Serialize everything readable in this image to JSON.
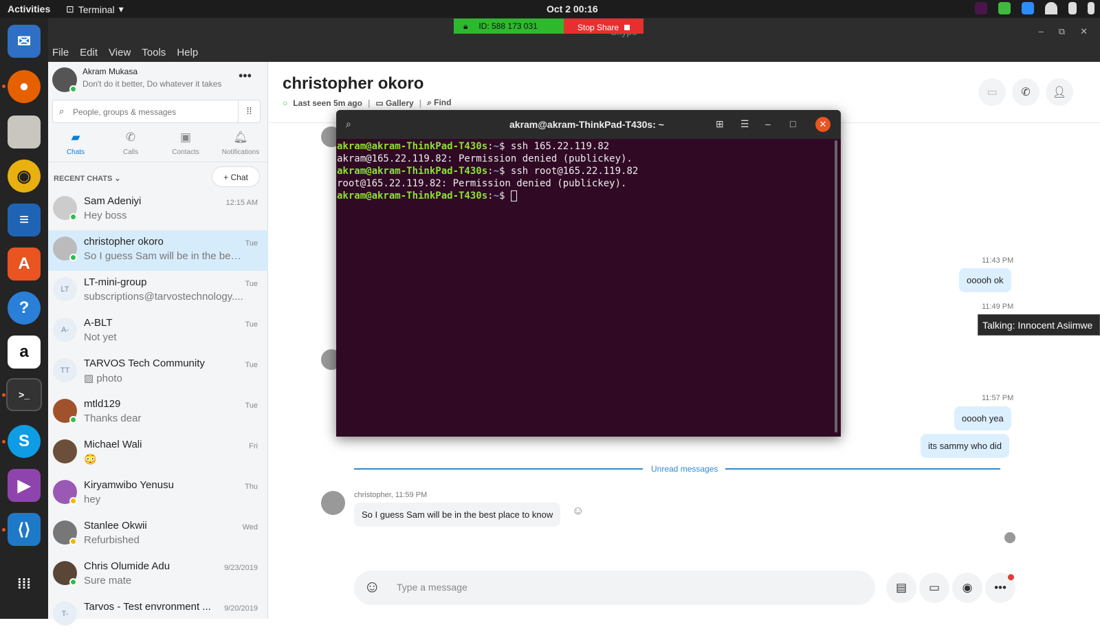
{
  "topbar": {
    "activities": "Activities",
    "app": "Terminal",
    "clock": "Oct 2  00:16"
  },
  "share": {
    "id_label": "ID: 588 173 031",
    "stop_label": "Stop Share"
  },
  "window_title": "Skype",
  "menu": [
    "File",
    "Edit",
    "View",
    "Tools",
    "Help"
  ],
  "profile": {
    "name": "Akram Mukasa",
    "mood": "Don't do it better,  Do whatever it takes"
  },
  "search": {
    "placeholder": "People, groups & messages"
  },
  "tabs": [
    {
      "label": "Chats"
    },
    {
      "label": "Calls"
    },
    {
      "label": "Contacts"
    },
    {
      "label": "Notifications"
    }
  ],
  "recent": {
    "header": "RECENT CHATS",
    "new_chat": "Chat"
  },
  "chats": [
    {
      "name": "Sam Adeniyi",
      "preview": "Hey boss",
      "time": "12:15 AM",
      "initials": ""
    },
    {
      "name": "christopher okoro",
      "preview": "So I guess Sam will be in the best ...",
      "time": "Tue",
      "initials": ""
    },
    {
      "name": "LT-mini-group",
      "preview": "subscriptions@tarvostechnology....",
      "time": "Tue",
      "initials": "LT"
    },
    {
      "name": "A-BLT",
      "preview": "Not yet",
      "time": "Tue",
      "initials": "A-"
    },
    {
      "name": "TARVOS Tech Community",
      "preview": "photo",
      "time": "Tue",
      "initials": "TT"
    },
    {
      "name": "mtld129",
      "preview": "Thanks dear",
      "time": "Tue",
      "initials": ""
    },
    {
      "name": "Michael Wali",
      "preview": "😳",
      "time": "Fri",
      "initials": ""
    },
    {
      "name": "Kiryamwibo Yenusu",
      "preview": "hey",
      "time": "Thu",
      "initials": ""
    },
    {
      "name": "Stanlee Okwii",
      "preview": "Refurbished",
      "time": "Wed",
      "initials": ""
    },
    {
      "name": "Chris Olumide Adu",
      "preview": "Sure mate",
      "time": "9/23/2019",
      "initials": ""
    },
    {
      "name": "Tarvos - Test envronment ...",
      "preview": "",
      "time": "9/20/2019",
      "initials": "T-"
    }
  ],
  "conversation": {
    "name": "christopher okoro",
    "last_seen": "Last seen 5m ago",
    "gallery": "Gallery",
    "find": "Find",
    "messages": [
      {
        "time": "11:43 PM",
        "text": "ooooh ok"
      },
      {
        "time": "11:49 PM",
        "text": ""
      },
      {
        "time": "11:57 PM",
        "text": "ooooh yea"
      },
      {
        "time": "",
        "text": "its sammy who did"
      }
    ],
    "unread_label": "Unread messages",
    "incoming": {
      "sender_time": "christopher, 11:59 PM",
      "text": "So I guess Sam will be in the best place to know"
    },
    "composer_placeholder": "Type a message"
  },
  "tooltip": "Talking: Innocent Asiimwe",
  "terminal": {
    "title": "akram@akram-ThinkPad-T430s: ~",
    "lines": [
      {
        "user": "akram@akram-ThinkPad-T430s",
        "path": "~",
        "cmd": "ssh 165.22.119.82"
      },
      {
        "out": "akram@165.22.119.82: Permission denied (publickey)."
      },
      {
        "user": "akram@akram-ThinkPad-T430s",
        "path": "~",
        "cmd": "ssh root@165.22.119.82"
      },
      {
        "out": "root@165.22.119.82: Permission denied (publickey)."
      },
      {
        "user": "akram@akram-ThinkPad-T430s",
        "path": "~",
        "cmd": ""
      }
    ]
  }
}
